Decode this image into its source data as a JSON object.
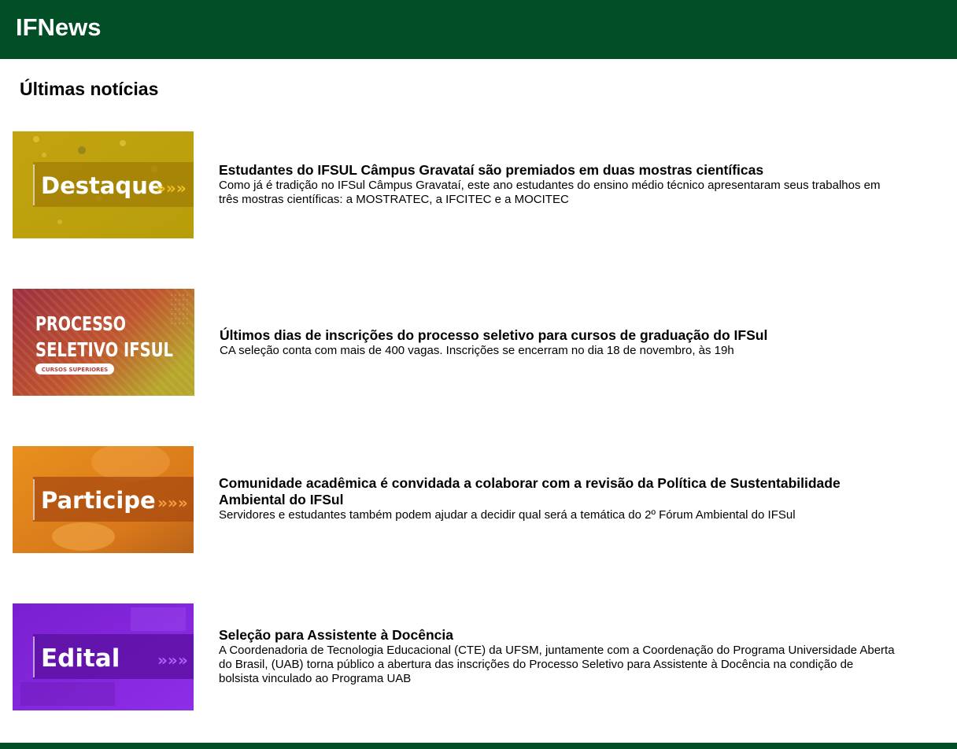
{
  "header": {
    "brand": "IFNews"
  },
  "section_title": "Últimas notícias",
  "news": [
    {
      "thumb_label": "Destaque",
      "title": "Estudantes do IFSUL Câmpus Gravataí são premiados em duas mostras científicas",
      "description": "Como já é tradição no IFSul Câmpus Gravataí, este ano estudantes do ensino médio técnico apresentaram seus trabalhos em três mostras científicas: a MOSTRATEC, a IFCITEC e a MOCITEC"
    },
    {
      "thumb_label_line1": "PROCESSO",
      "thumb_label_line2": "SELETIVO IFSUL",
      "thumb_badge": "CURSOS SUPERIORES",
      "title": "Últimos dias de inscrições do processo seletivo para cursos de graduação do IFSul",
      "description": "CA seleção conta com mais de 400 vagas. Inscrições se encerram no dia 18 de novembro, às 19h"
    },
    {
      "thumb_label": "Participe",
      "title": "Comunidade acadêmica é convidada a colaborar com a revisão da Política de Sustentabilidade Ambiental do IFSul",
      "description": "Servidores e estudantes também podem ajudar a decidir qual será a temática do 2º Fórum Ambiental do IFSul"
    },
    {
      "thumb_label": "Edital",
      "title": "Seleção para Assistente à Docência",
      "description": "A Coordenadoria de Tecnologia Educacional (CTE) da UFSM, juntamente com a Coordenação do Programa Universidade Aberta do Brasil, (UAB) torna público a abertura das inscrições do Processo Seletivo para Assistente à Docência na condição de bolsista vinculado ao Programa UAB"
    }
  ],
  "colors": {
    "header_bg": "#004d26",
    "destaque": "#c9ad12",
    "processo": "#b0423a",
    "participe": "#e58a1e",
    "edital": "#8a2be2"
  }
}
